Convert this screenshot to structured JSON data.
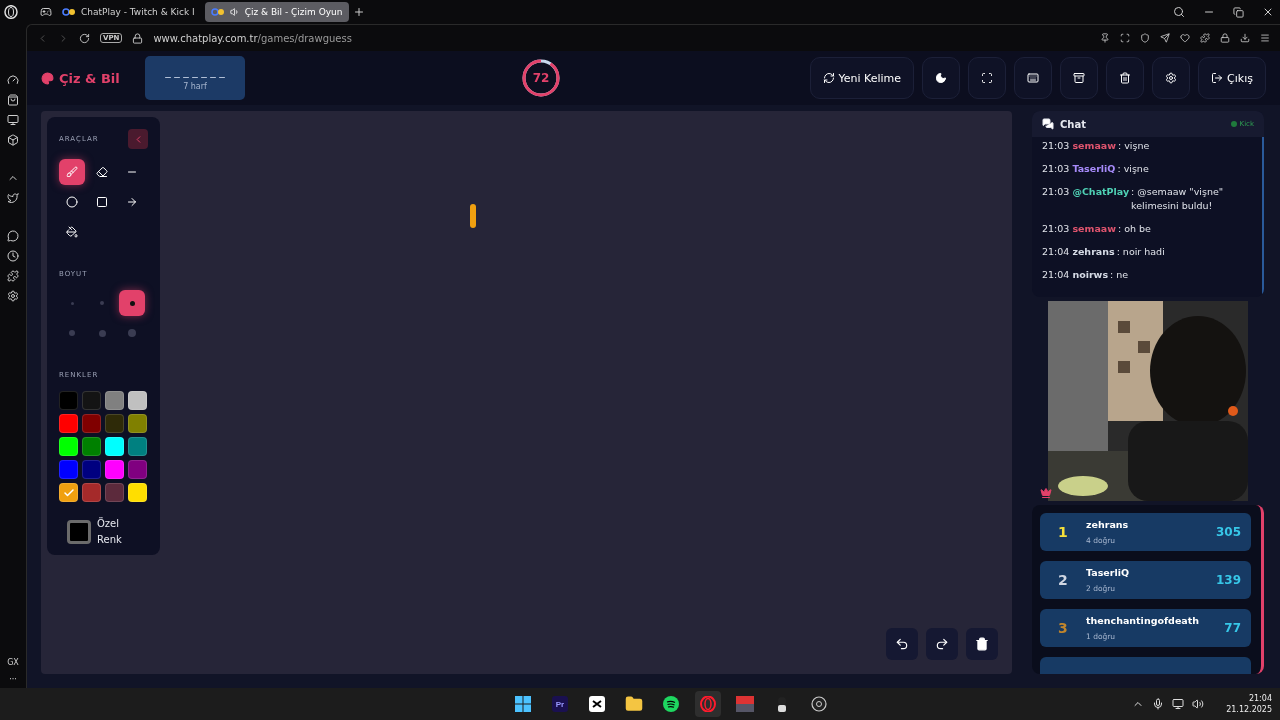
{
  "browser": {
    "tabs": [
      {
        "title": "ChatPlay - Twitch & Kick I",
        "selected": false,
        "audio": false
      },
      {
        "title": "Çiz & Bil - Çizim Oyun",
        "selected": true,
        "audio": true
      }
    ],
    "vpn": "VPN",
    "url_host": "www.chatplay.com.tr",
    "url_path": "/games/drawguess",
    "sidebar_label": "GX",
    "sidebar_more": "···"
  },
  "header": {
    "logo": "Çiz & Bil",
    "word": {
      "mask": "_ _ _ _ _ _ _",
      "hint": "7 harf"
    },
    "timer": {
      "value": "72"
    },
    "buttons": [
      {
        "kind": "refresh",
        "label": "Yeni Kelime"
      },
      {
        "kind": "theme"
      },
      {
        "kind": "fullscreen"
      },
      {
        "kind": "keyboard"
      },
      {
        "kind": "archive"
      },
      {
        "kind": "trash"
      },
      {
        "kind": "settings"
      },
      {
        "kind": "logout",
        "label": "Çıkış"
      }
    ]
  },
  "tools_panel": {
    "title": "ARAÇLAR",
    "tools": [
      {
        "kind": "brush",
        "selected": true
      },
      {
        "kind": "eraser",
        "selected": false
      },
      {
        "kind": "line",
        "selected": false
      },
      {
        "kind": "circle",
        "selected": false
      },
      {
        "kind": "rect",
        "selected": false
      },
      {
        "kind": "arrow",
        "selected": false
      },
      {
        "kind": "fill",
        "selected": false
      }
    ],
    "size_title": "BOYUT",
    "sizes": [
      {
        "selected": false
      },
      {
        "selected": false
      },
      {
        "selected": true
      },
      {
        "selected": false
      },
      {
        "selected": false
      },
      {
        "selected": false
      }
    ],
    "colors_title": "RENKLER",
    "colors": [
      {
        "color": "#000000",
        "selected": false
      },
      {
        "color": "#141414",
        "selected": false
      },
      {
        "color": "#808080",
        "selected": false
      },
      {
        "color": "#c0c0c0",
        "selected": false
      },
      {
        "color": "#ff0000",
        "selected": false
      },
      {
        "color": "#800000",
        "selected": false
      },
      {
        "color": "#2e2a08",
        "selected": false
      },
      {
        "color": "#808000",
        "selected": false
      },
      {
        "color": "#00ff00",
        "selected": false
      },
      {
        "color": "#008000",
        "selected": false
      },
      {
        "color": "#00ffff",
        "selected": false
      },
      {
        "color": "#008080",
        "selected": false
      },
      {
        "color": "#0000ff",
        "selected": false
      },
      {
        "color": "#000080",
        "selected": false
      },
      {
        "color": "#ff00ff",
        "selected": false
      },
      {
        "color": "#800080",
        "selected": false
      },
      {
        "color": "#f0a010",
        "selected": true
      },
      {
        "color": "#a52a2a",
        "selected": false
      },
      {
        "color": "#5c2a3c",
        "selected": false
      },
      {
        "color": "#ffde00",
        "selected": false
      }
    ],
    "custom_label": "Özel Renk"
  },
  "chat": {
    "title": "Chat",
    "platform": "Kick",
    "messages": [
      {
        "time": "21:03",
        "user": "semaaw",
        "color": "#e0546e",
        "text": ": vişne"
      },
      {
        "time": "21:03",
        "user": "TaserliQ",
        "color": "#a78bfa",
        "text": ": vişne"
      },
      {
        "time": "21:03",
        "user": "@ChatPlay",
        "color": "#4fd1b5",
        "text": ": @semaaw \"vişne\" kelimesini buldu!"
      },
      {
        "time": "21:03",
        "user": "semaaw",
        "color": "#e0546e",
        "text": ": oh be"
      },
      {
        "time": "21:04",
        "user": "zehrans",
        "color": "#d6dbe6",
        "text": ": noir hadi"
      },
      {
        "time": "21:04",
        "user": "noirws",
        "color": "#d6dbe6",
        "text": ": ne"
      }
    ]
  },
  "leaderboard": [
    {
      "rank": "1",
      "name": "zehrans",
      "correct": "4 doğru",
      "score": "305",
      "color": "#f5e03a"
    },
    {
      "rank": "2",
      "name": "TaserliQ",
      "correct": "2 doğru",
      "score": "139",
      "color": "#d0d6e2"
    },
    {
      "rank": "3",
      "name": "thenchantingofdeath",
      "correct": "1 doğru",
      "score": "77",
      "color": "#c0852c"
    }
  ],
  "taskbar": {
    "apps": [
      {
        "kind": "windows",
        "active": false
      },
      {
        "kind": "premiere",
        "active": false
      },
      {
        "kind": "capcut",
        "active": false
      },
      {
        "kind": "folder",
        "active": false
      },
      {
        "kind": "spotify",
        "active": false
      },
      {
        "kind": "opera",
        "active": true
      },
      {
        "kind": "voicemeeter",
        "active": false
      },
      {
        "kind": "avatar",
        "active": false
      },
      {
        "kind": "obs",
        "active": false
      }
    ],
    "time": "21:04",
    "date": "21.12.2025",
    "premiere_label": "Pr"
  }
}
